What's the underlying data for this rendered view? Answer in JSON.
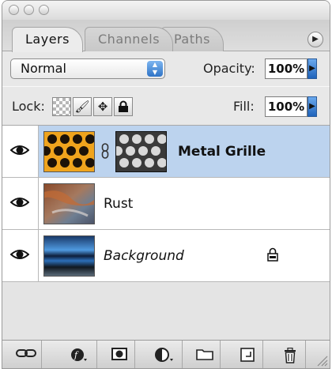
{
  "tabs": [
    {
      "label": "Layers",
      "active": true
    },
    {
      "label": "Channels",
      "active": false
    },
    {
      "label": "Paths",
      "active": false
    }
  ],
  "options": {
    "blend_mode": "Normal",
    "opacity_label": "Opacity:",
    "opacity_value": "100%",
    "lock_label": "Lock:",
    "fill_label": "Fill:",
    "fill_value": "100%"
  },
  "layers": [
    {
      "name": "Metal Grille",
      "visible": true,
      "selected": true,
      "has_mask": true,
      "style": "bold"
    },
    {
      "name": "Rust",
      "visible": true,
      "selected": false,
      "has_mask": false,
      "style": "normal"
    },
    {
      "name": "Background",
      "visible": true,
      "selected": false,
      "locked": true,
      "style": "italic"
    }
  ],
  "bottom_bar_icons": [
    "link-layers-icon",
    "layer-style-icon",
    "add-mask-icon",
    "adjustment-layer-icon",
    "new-group-icon",
    "new-layer-icon",
    "trash-icon"
  ],
  "colors": {
    "selection": "#bcd3ee",
    "accent": "#2f74c7"
  }
}
